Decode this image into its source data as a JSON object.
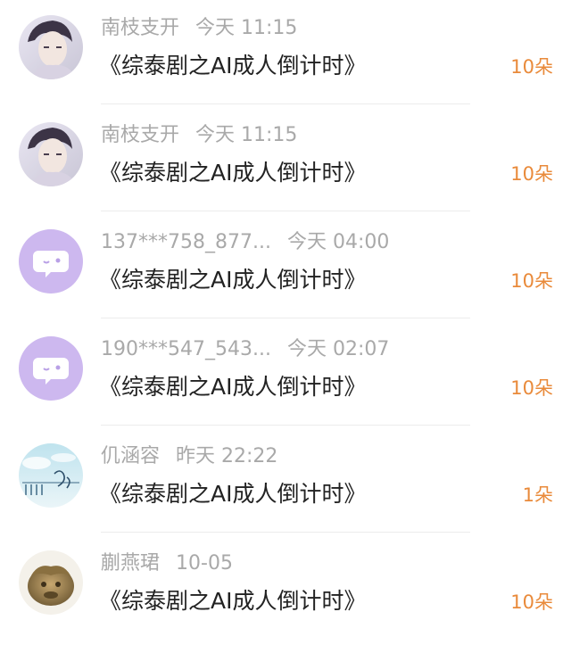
{
  "gifts": [
    {
      "user": "南枝支开",
      "time": "今天 11:15",
      "title": "《综泰剧之AI成人倒计时》",
      "amount": "10朵",
      "avatar_icon": "portrait-avatar-icon"
    },
    {
      "user": "南枝支开",
      "time": "今天 11:15",
      "title": "《综泰剧之AI成人倒计时》",
      "amount": "10朵",
      "avatar_icon": "portrait-avatar-icon"
    },
    {
      "user": "137***758_877...",
      "time": "今天 04:00",
      "title": "《综泰剧之AI成人倒计时》",
      "amount": "10朵",
      "avatar_icon": "default-chat-bubble-avatar-icon"
    },
    {
      "user": "190***547_543...",
      "time": "今天 02:07",
      "title": "《综泰剧之AI成人倒计时》",
      "amount": "10朵",
      "avatar_icon": "default-chat-bubble-avatar-icon"
    },
    {
      "user": "仉涵容",
      "time": "昨天 22:22",
      "title": "《综泰剧之AI成人倒计时》",
      "amount": "1朵",
      "avatar_icon": "sky-landscape-avatar-icon"
    },
    {
      "user": "蒯燕珺",
      "time": "10-05",
      "title": "《综泰剧之AI成人倒计时》",
      "amount": "10朵",
      "avatar_icon": "figurine-avatar-icon"
    }
  ],
  "colors": {
    "meta_text": "#a9a9a9",
    "title_text": "#222222",
    "amount_accent": "#e98a3a",
    "default_avatar_bg": "#cdb8ef",
    "divider": "#ececec"
  }
}
